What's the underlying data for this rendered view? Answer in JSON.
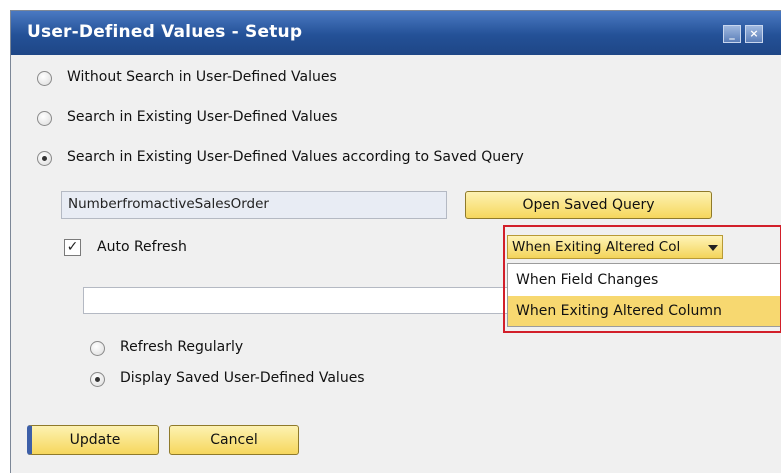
{
  "window": {
    "title": "User-Defined Values - Setup"
  },
  "options": {
    "without_search": "Without Search in User-Defined Values",
    "search_existing": "Search in Existing User-Defined Values",
    "search_saved_query": "Search in Existing User-Defined Values according to Saved Query"
  },
  "query": {
    "field_value": "NumberfromactiveSalesOrder",
    "open_button": "Open Saved Query"
  },
  "auto_refresh": {
    "label": "Auto Refresh",
    "checked": true,
    "dropdown_value": "When Exiting Altered Col",
    "menu_items": [
      "When Field Changes",
      "When Exiting Altered Column"
    ]
  },
  "refresh_options": {
    "regularly": "Refresh Regularly",
    "display_saved": "Display Saved User-Defined Values"
  },
  "buttons": {
    "update": "Update",
    "cancel": "Cancel"
  },
  "colors": {
    "title_bar": "#245197",
    "highlight": "#d21f2a",
    "button_yellow": "#f6d75d"
  }
}
